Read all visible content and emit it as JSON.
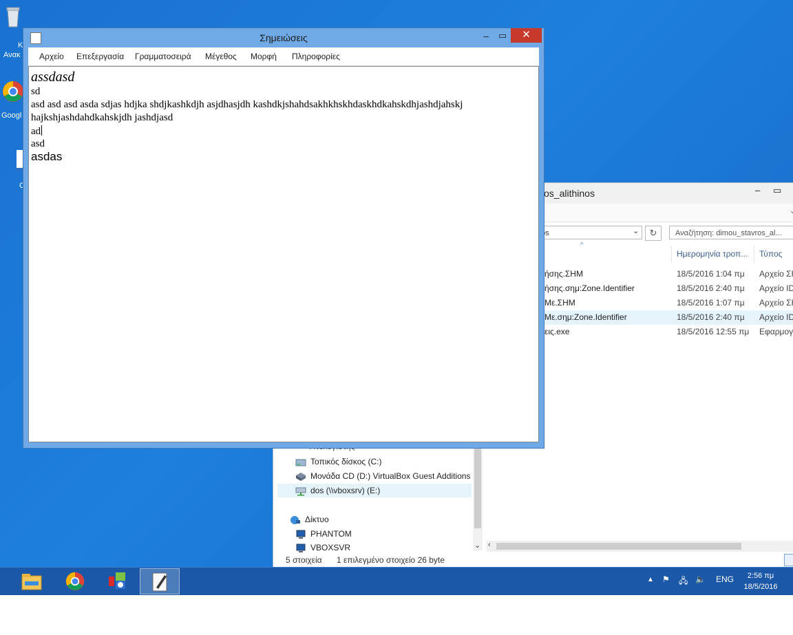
{
  "desktop": {
    "icons": [
      {
        "label": "Κ\nΑνακ",
        "name": "recycle-bin"
      },
      {
        "label": "Googl",
        "name": "google-chrome"
      },
      {
        "label": "C",
        "name": "shortcut"
      }
    ]
  },
  "explorer": {
    "title": "os_alithinos",
    "address": "os",
    "search_placeholder": "Αναζήτηση: dimou_stavros_al...",
    "columns": {
      "date": "Ημερομηνία τροπ...",
      "type": "Τύπος"
    },
    "files": [
      {
        "name": "ήσης.ΣΗΜ",
        "date": "18/5/2016 1:04 πμ",
        "type": "Αρχείο ΣΗ"
      },
      {
        "name": "ήσης.σημ:Zone.Identifier",
        "date": "18/5/2016 2:40 πμ",
        "type": "Αρχείο ID"
      },
      {
        "name": "Με.ΣΗΜ",
        "date": "18/5/2016 1:07 πμ",
        "type": "Αρχείο ΣΗ"
      },
      {
        "name": "Με.σημ:Zone.Identifier",
        "date": "18/5/2016 2:40 πμ",
        "type": "Αρχείο ID"
      },
      {
        "name": "εις.exe",
        "date": "18/5/2016 12:55 πμ",
        "type": "Εφαρμογ"
      }
    ],
    "nav": {
      "computer": "Υπολογιστής",
      "local_disk": "Τοπικός δίσκος (C:)",
      "cd_drive": "Μονάδα CD (D:) VirtualBox Guest Additions",
      "network_drive": "dos (\\\\vboxsrv) (E:)",
      "network": "Δίκτυο",
      "phantom": "PHANTOM",
      "vboxsvr": "VBOXSVR"
    },
    "status": {
      "count": "5 στοιχεία",
      "selected": "1 επιλεγμένο στοιχείο  26 byte"
    }
  },
  "notepad": {
    "title": "Σημειώσεις",
    "menu": [
      "Αρχείο",
      "Επεξεργασία",
      "Γραμματοσειρά",
      "Μέγεθος",
      "Μορφή",
      "Πληροφορίες"
    ],
    "lines": [
      "assdasd",
      "sd",
      "asd asd asd asda sdjas hdjka shdjkashkdjh asjdhasjdh kashdkjshahdsakhkhskhdaskhdkahskdhjashdjahskj",
      "hajkshjashdahdkahskjdh jashdjasd",
      "ad",
      "asd",
      "asdas"
    ]
  },
  "taskbar": {
    "apps": [
      "file-explorer",
      "google-chrome",
      "control-panel",
      "notepad"
    ],
    "language": "ENG",
    "time": "2:56 πμ",
    "date": "18/5/2016"
  }
}
